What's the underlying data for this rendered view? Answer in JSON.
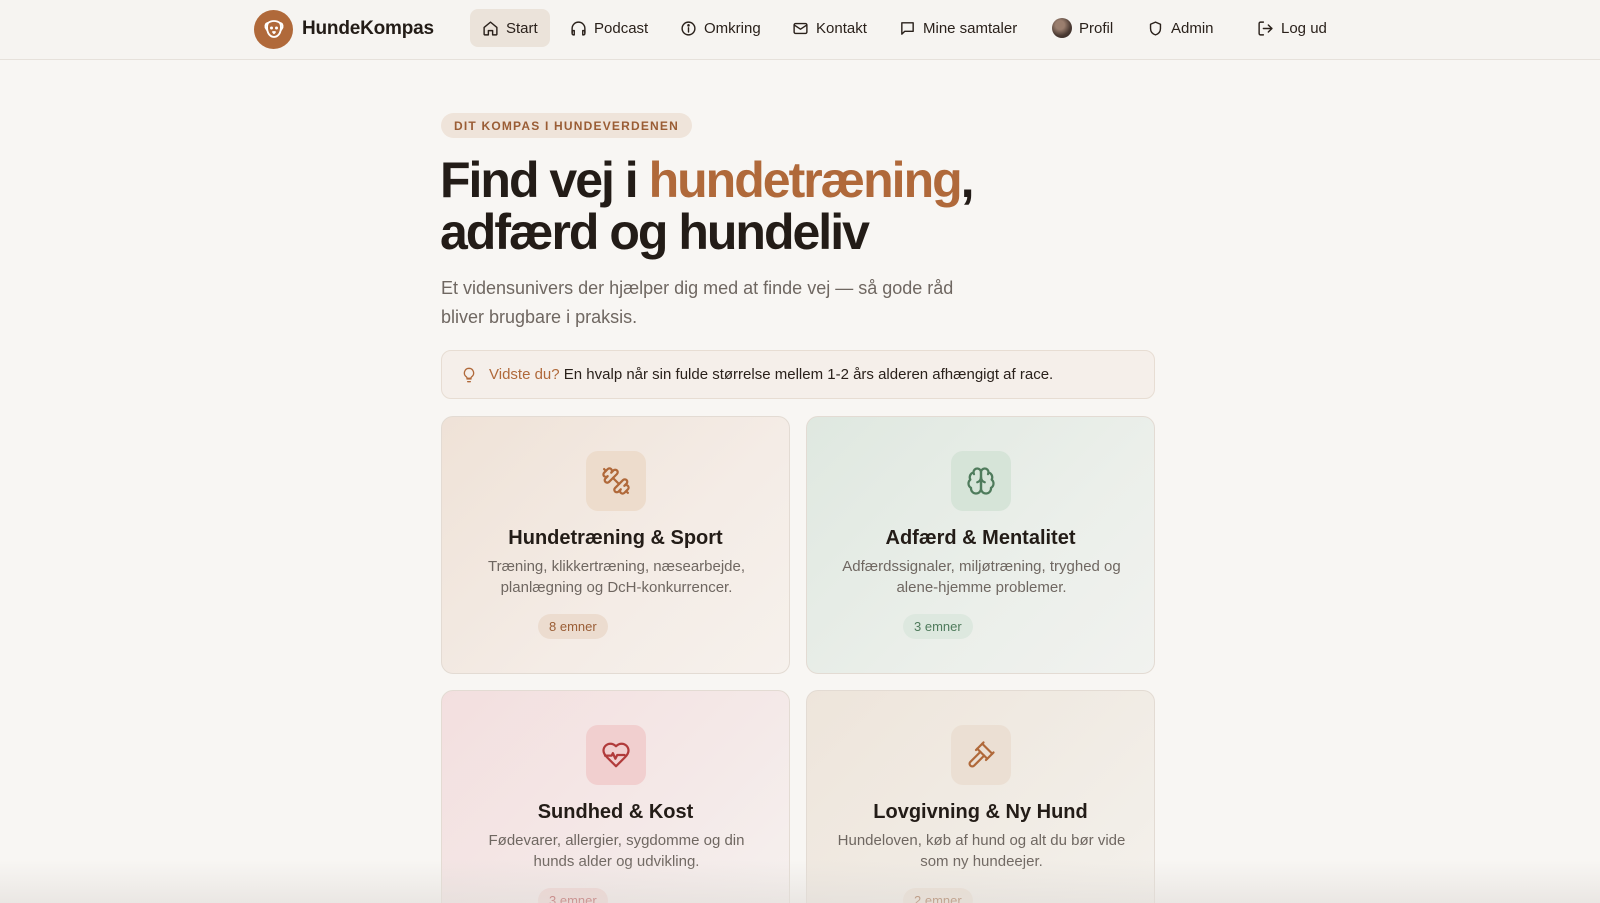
{
  "nav": {
    "brand": "HundeKompas",
    "items": [
      {
        "label": "Start",
        "icon": "home-icon",
        "active": true
      },
      {
        "label": "Podcast",
        "icon": "headphones-icon"
      },
      {
        "label": "Omkring",
        "icon": "info-icon"
      },
      {
        "label": "Kontakt",
        "icon": "mail-icon"
      },
      {
        "label": "Mine samtaler",
        "icon": "chat-icon"
      },
      {
        "label": "Profil",
        "icon": "avatar"
      },
      {
        "label": "Admin",
        "icon": "shield-icon"
      },
      {
        "label": "Log ud",
        "icon": "logout-icon"
      }
    ]
  },
  "hero": {
    "eyebrow": "DIT KOMPAS I HUNDEVERDENEN",
    "headline_part1": "Find vej i ",
    "headline_accent": "hundetræning",
    "headline_part2": ",",
    "headline_line2": "adfærd og hundeliv",
    "subtitle": "Et vidensunivers der hjælper dig med at finde vej — så gode råd bliver brugbare i praksis."
  },
  "tip": {
    "label": "Vidste du?",
    "text": "En hvalp når sin fulde størrelse mellem 1-2 års alderen afhængigt af race."
  },
  "categories": [
    {
      "title": "Hundetræning & Sport",
      "description": "Træning, klikkertræning, næsearbejde, planlægning og DcH-konkurrencer.",
      "count": "8 emner",
      "icon": "dumbbell-icon"
    },
    {
      "title": "Adfærd & Mentalitet",
      "description": "Adfærdssignaler, miljøtræning, tryghed og alene-hjemme problemer.",
      "count": "3 emner",
      "icon": "brain-icon"
    },
    {
      "title": "Sundhed & Kost",
      "description": "Fødevarer, allergier, sygdomme og din hunds alder og udvikling.",
      "count": "3 emner",
      "icon": "heart-pulse-icon"
    },
    {
      "title": "Lovgivning & Ny Hund",
      "description": "Hundeloven, køb af hund og alt du bør vide som ny hundeejer.",
      "count": "2 emner",
      "icon": "gavel-icon"
    }
  ],
  "colors": {
    "accent": "#b0693a",
    "background": "#f8f6f3",
    "text": "#231c17",
    "green": "#4f7b5c",
    "red": "#b13b3b"
  }
}
